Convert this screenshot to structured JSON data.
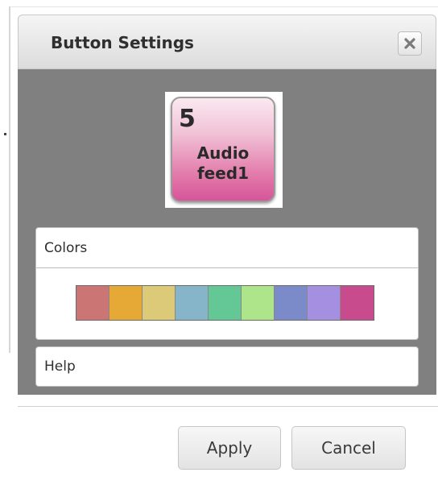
{
  "dialog": {
    "title": "Button Settings",
    "close_icon": "close-icon"
  },
  "preview": {
    "number": "5",
    "label_line1": "Audio",
    "label_line2": "feed1",
    "color": "#d7559a"
  },
  "colors_panel": {
    "header": "Colors",
    "swatches": [
      "#cc7575",
      "#e6a935",
      "#dcca78",
      "#86b4c9",
      "#64c896",
      "#aee48a",
      "#7b8ac8",
      "#a48fe0",
      "#c84b8d"
    ]
  },
  "help_panel": {
    "header": "Help"
  },
  "footer": {
    "apply_label": "Apply",
    "cancel_label": "Cancel"
  }
}
